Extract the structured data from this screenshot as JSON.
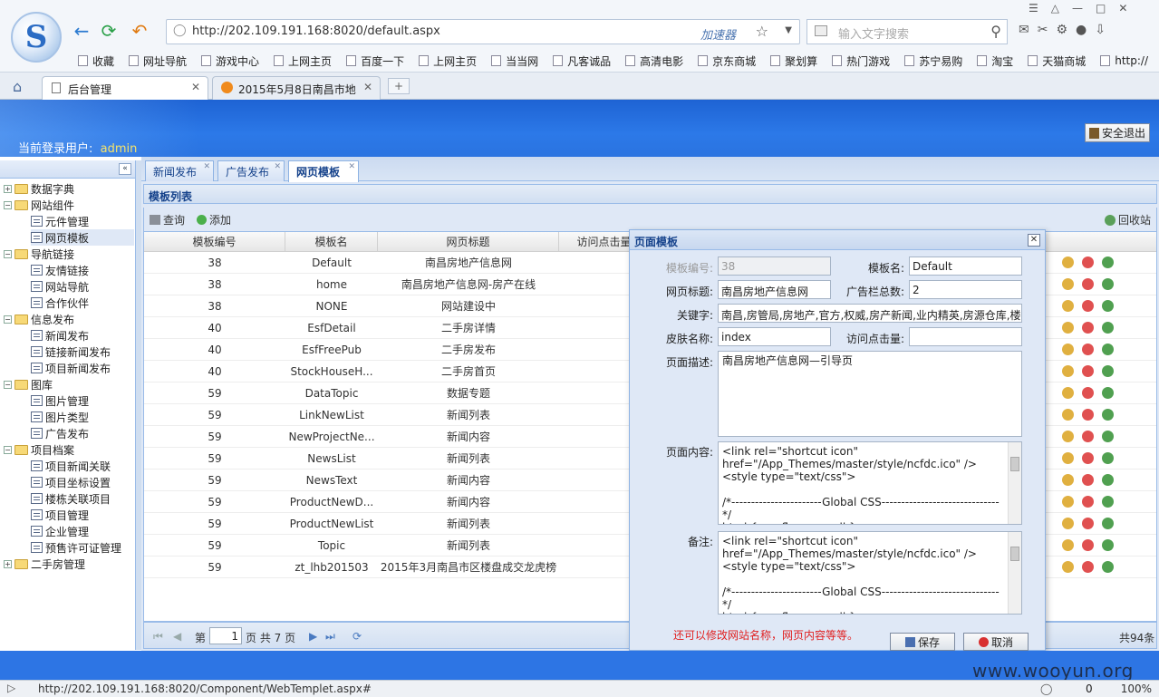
{
  "browser": {
    "url": "http://202.109.191.168:8020/default.aspx",
    "accelerator": "加速器",
    "search_placeholder": "输入文字搜索",
    "bookmarks": [
      "收藏",
      "网址导航",
      "游戏中心",
      "上网主页",
      "百度一下",
      "上网主页",
      "当当网",
      "凡客诚品",
      "高清电影",
      "京东商城",
      "聚划算",
      "热门游戏",
      "苏宁易购",
      "淘宝",
      "天猫商城",
      "http://"
    ],
    "tabs": [
      "后台管理",
      "2015年5月8日南昌市地"
    ],
    "status_url": "http://202.109.191.168:8020/Component/WebTemplet.aspx#",
    "status_count": "0",
    "zoom": "100%"
  },
  "app": {
    "user_label": "当前登录用户:",
    "user_name": "admin",
    "logout": "安全退出"
  },
  "sidebar": {
    "items": [
      {
        "label": "数据字典",
        "type": "folder",
        "level": 0
      },
      {
        "label": "网站组件",
        "type": "folder",
        "level": 0
      },
      {
        "label": "元件管理",
        "type": "leaf",
        "level": 1
      },
      {
        "label": "网页模板",
        "type": "leaf",
        "level": 1
      },
      {
        "label": "导航链接",
        "type": "folder",
        "level": 0
      },
      {
        "label": "友情链接",
        "type": "leaf",
        "level": 1
      },
      {
        "label": "网站导航",
        "type": "leaf",
        "level": 1
      },
      {
        "label": "合作伙伴",
        "type": "leaf",
        "level": 1
      },
      {
        "label": "信息发布",
        "type": "folder",
        "level": 0
      },
      {
        "label": "新闻发布",
        "type": "leaf",
        "level": 1
      },
      {
        "label": "链接新闻发布",
        "type": "leaf",
        "level": 1
      },
      {
        "label": "项目新闻发布",
        "type": "leaf",
        "level": 1
      },
      {
        "label": "图库",
        "type": "folder",
        "level": 0
      },
      {
        "label": "图片管理",
        "type": "leaf",
        "level": 1
      },
      {
        "label": "图片类型",
        "type": "leaf",
        "level": 1
      },
      {
        "label": "广告发布",
        "type": "leaf",
        "level": 1
      },
      {
        "label": "项目档案",
        "type": "folder",
        "level": 0
      },
      {
        "label": "项目新闻关联",
        "type": "leaf",
        "level": 1
      },
      {
        "label": "项目坐标设置",
        "type": "leaf",
        "level": 1
      },
      {
        "label": "楼栋关联项目",
        "type": "leaf",
        "level": 1
      },
      {
        "label": "项目管理",
        "type": "leaf",
        "level": 1
      },
      {
        "label": "企业管理",
        "type": "leaf",
        "level": 1
      },
      {
        "label": "预售许可证管理",
        "type": "leaf",
        "level": 1
      },
      {
        "label": "二手房管理",
        "type": "folder",
        "level": 0
      }
    ]
  },
  "content_tabs": [
    "新闻发布",
    "广告发布",
    "网页模板"
  ],
  "panel_title": "模板列表",
  "toolbar": {
    "query": "查询",
    "add": "添加",
    "recycle": "回收站"
  },
  "grid": {
    "columns": [
      "模板编号",
      "模板名",
      "网页标题",
      "访问点击量"
    ],
    "rows": [
      [
        "38",
        "Default",
        "南昌房地产信息网"
      ],
      [
        "38",
        "home",
        "南昌房地产信息网-房产在线"
      ],
      [
        "38",
        "NONE",
        "网站建设中"
      ],
      [
        "40",
        "EsfDetail",
        "二手房详情"
      ],
      [
        "40",
        "EsfFreePub",
        "二手房发布"
      ],
      [
        "40",
        "StockHouseH...",
        "二手房首页"
      ],
      [
        "59",
        "DataTopic",
        "数据专题"
      ],
      [
        "59",
        "LinkNewList",
        "新闻列表"
      ],
      [
        "59",
        "NewProjectNe...",
        "新闻内容"
      ],
      [
        "59",
        "NewsList",
        "新闻列表"
      ],
      [
        "59",
        "NewsText",
        "新闻内容"
      ],
      [
        "59",
        "ProductNewD...",
        "新闻内容"
      ],
      [
        "59",
        "ProductNewList",
        "新闻列表"
      ],
      [
        "59",
        "Topic",
        "新闻列表"
      ],
      [
        "59",
        "zt_lhb201503",
        "2015年3月南昌市区楼盘成交龙虎榜"
      ]
    ]
  },
  "pager": {
    "prefix": "第",
    "page": "1",
    "suffix": "页 共 7 页",
    "total": "共94条"
  },
  "dialog": {
    "title": "页面模板",
    "labels": {
      "id": "模板编号:",
      "name": "模板名:",
      "title": "网页标题:",
      "adcount": "广告栏总数:",
      "keywords": "关键字:",
      "skin": "皮肤名称:",
      "hits": "访问点击量:",
      "desc": "页面描述:",
      "content": "页面内容:",
      "remark": "备注:"
    },
    "values": {
      "id": "38",
      "name": "Default",
      "title": "南昌房地产信息网",
      "adcount": "2",
      "keywords": "南昌,房管局,房地产,官方,权威,房产新闻,业内精英,房源仓库,楼",
      "skin": "index",
      "hits": "",
      "desc": "南昌房地产信息网—引导页",
      "content": "<link rel=\"shortcut icon\"\nhref=\"/App_Themes/master/style/ncfdc.ico\" />\n<style type=\"text/css\">\n\n/*-----------------------Global CSS------------------------------ */\nhtml {overflow-y:scroll;}",
      "remark": "<link rel=\"shortcut icon\"\nhref=\"/App_Themes/master/style/ncfdc.ico\" />\n<style type=\"text/css\">\n\n/*-----------------------Global CSS------------------------------ */\nhtml {overflow-y:scroll;}"
    },
    "note": "还可以修改网站名称，网页内容等等。",
    "save": "保存",
    "cancel": "取消"
  },
  "watermark": "www.wooyun.org",
  "colors": {
    "header_blue": "#2c79e8",
    "accent_red": "#e02020",
    "user_yellow": "#f5e36b"
  }
}
